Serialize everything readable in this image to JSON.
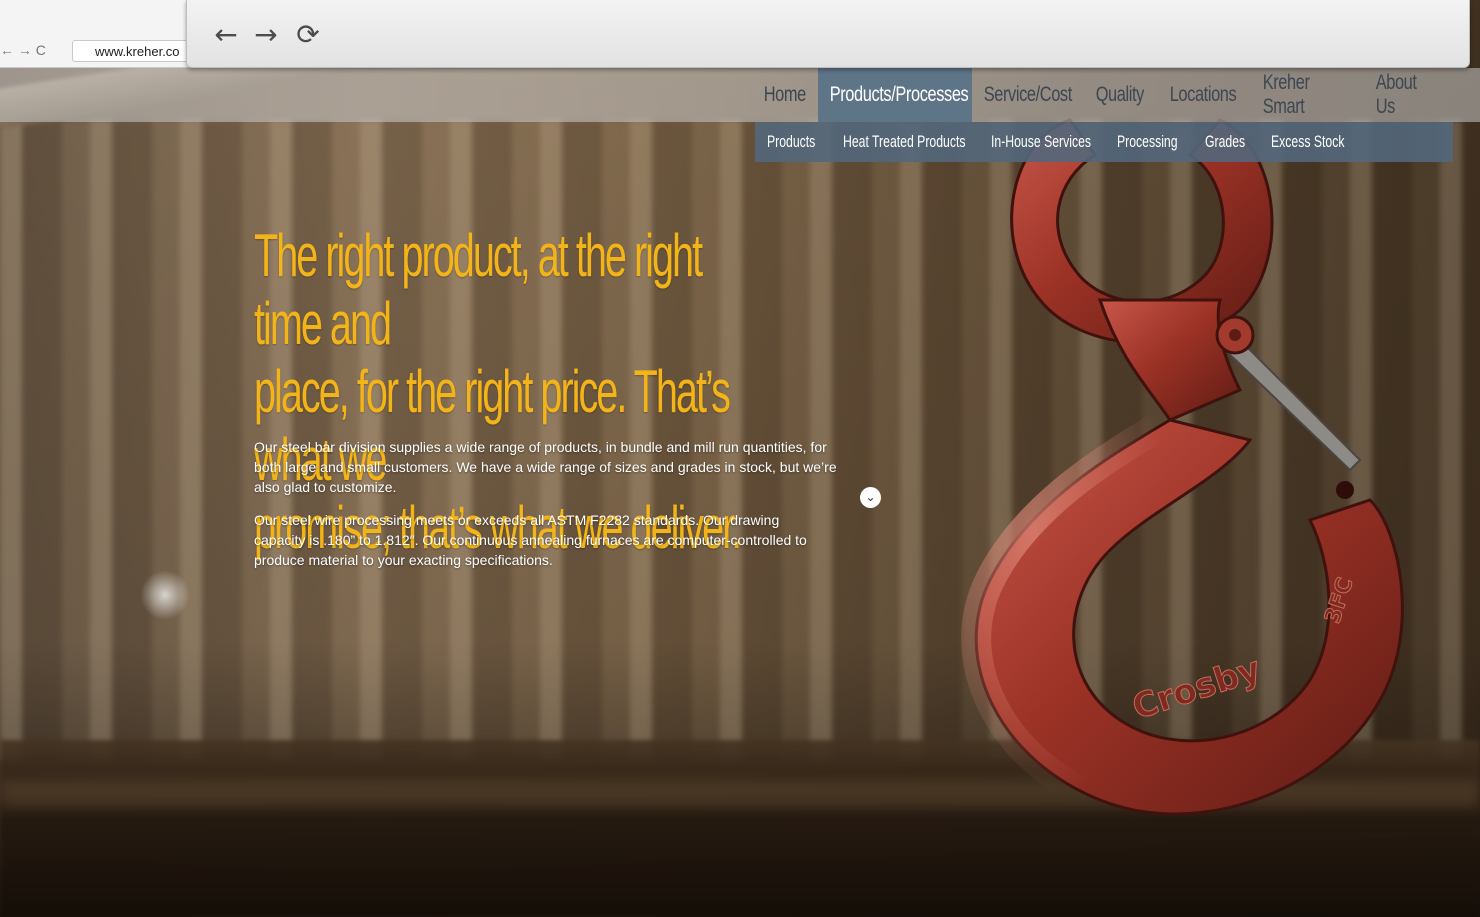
{
  "browser": {
    "url": "www.kreher.co",
    "back_icon": "arrow-left-icon",
    "forward_icon": "arrow-right-icon",
    "reload_icon": "reload-icon"
  },
  "nav": {
    "items": [
      {
        "label": "Home",
        "active": false
      },
      {
        "label": "Products/Processes",
        "active": true
      },
      {
        "label": "Service/Cost",
        "active": false
      },
      {
        "label": "Quality",
        "active": false
      },
      {
        "label": "Locations",
        "active": false
      },
      {
        "label": "Kreher Smart",
        "active": false
      },
      {
        "label": "About Us",
        "active": false
      }
    ],
    "subitems": [
      {
        "label": "Products"
      },
      {
        "label": "Heat Treated Products"
      },
      {
        "label": "In-House Services"
      },
      {
        "label": "Processing"
      },
      {
        "label": "Grades"
      },
      {
        "label": "Excess Stock"
      }
    ]
  },
  "hero": {
    "headline_lines": [
      "The right product, at the right time and",
      "place, for the right price. That’s what we",
      "promise; that’s what we deliver."
    ],
    "paragraph1": "Our steel bar division supplies a wide range of products, in bundle and mill run quantities, for both large and small customers. We have a wide range of sizes and grades in stock, but we’re also glad to customize.",
    "paragraph2": "Our steel wire processing meets or exceeds all ASTM F2282 standards. Our drawing capacity is .180” to 1.812″. Our continuous annealing furnaces are computer-controlled to produce material to your exacting specifications.",
    "scroll_icon": "chevron-down-icon"
  },
  "hook": {
    "brand_text": "Crosby",
    "side_text": "3FC"
  },
  "colors": {
    "accent": "#f2b418",
    "nav_active": "#5e7487",
    "subnav_bg": "#53677b",
    "hook_red": "#a8382b"
  }
}
